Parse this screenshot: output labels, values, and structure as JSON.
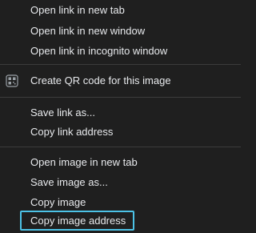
{
  "context_menu": {
    "group_link": [
      {
        "label": "Open link in new tab"
      },
      {
        "label": "Open link in new window"
      },
      {
        "label": "Open link in incognito window"
      }
    ],
    "group_qr": [
      {
        "label": "Create QR code for this image",
        "icon": "qr-code-icon"
      }
    ],
    "group_link_actions": [
      {
        "label": "Save link as..."
      },
      {
        "label": "Copy link address"
      }
    ],
    "group_image": [
      {
        "label": "Open image in new tab"
      },
      {
        "label": "Save image as..."
      },
      {
        "label": "Copy image"
      },
      {
        "label": "Copy image address",
        "highlighted": true
      }
    ]
  },
  "colors": {
    "background": "#1f1f1f",
    "text": "#e8eaed",
    "separator": "#3c3c3c",
    "focus_ring": "#4cc2e6"
  }
}
